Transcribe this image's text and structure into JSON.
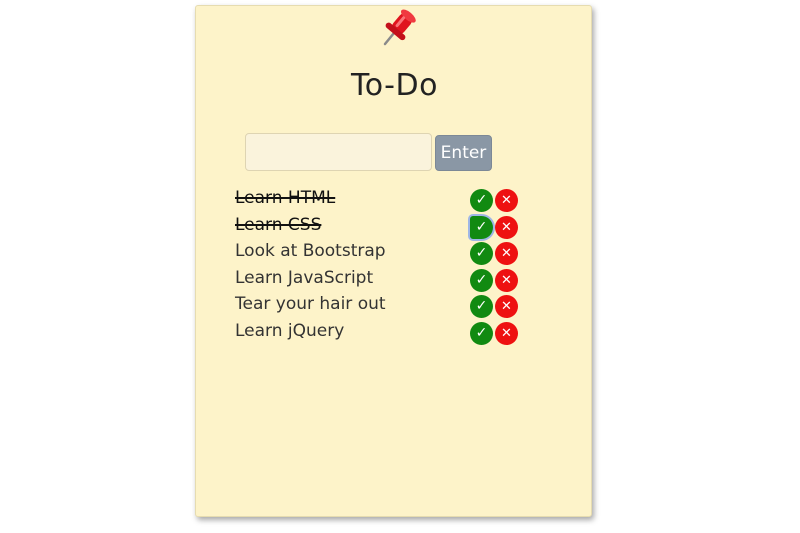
{
  "app": {
    "title": "To-Do",
    "pin_icon": "pushpin-icon"
  },
  "input": {
    "value": "",
    "placeholder": ""
  },
  "enter_button": {
    "label": "Enter"
  },
  "colors": {
    "card_background": "#fdf3c9",
    "enter_button": "#8a97a5",
    "check_button": "#118a11",
    "delete_button": "#ee1111"
  },
  "items": [
    {
      "label": "Learn HTML",
      "done": true,
      "check_symbol": "✓",
      "delete_symbol": "✕"
    },
    {
      "label": "Learn CSS",
      "done": true,
      "check_symbol": "✓",
      "delete_symbol": "✕"
    },
    {
      "label": "Look at Bootstrap",
      "done": false,
      "check_symbol": "✓",
      "delete_symbol": "✕"
    },
    {
      "label": "Learn JavaScript",
      "done": false,
      "check_symbol": "✓",
      "delete_symbol": "✕"
    },
    {
      "label": "Tear your hair out",
      "done": false,
      "check_symbol": "✓",
      "delete_symbol": "✕"
    },
    {
      "label": "Learn jQuery",
      "done": false,
      "check_symbol": "✓",
      "delete_symbol": "✕"
    }
  ]
}
